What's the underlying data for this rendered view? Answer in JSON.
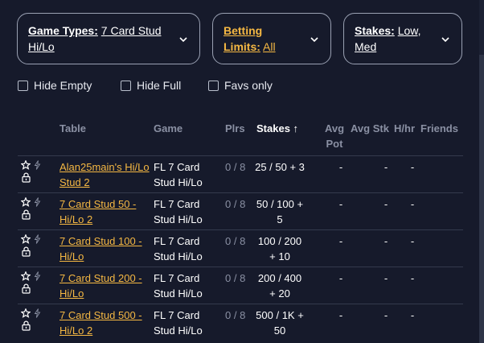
{
  "filters": {
    "game_types": {
      "label": "Game Types:",
      "value": "7 Card Stud Hi/Lo"
    },
    "betting_limits": {
      "label": "Betting Limits:",
      "value": "All"
    },
    "stakes": {
      "label": "Stakes:",
      "value": "Low, Med"
    }
  },
  "checkboxes": {
    "hide_empty": "Hide Empty",
    "hide_full": "Hide Full",
    "favs_only": "Favs only"
  },
  "table": {
    "headers": {
      "table": "Table",
      "game": "Game",
      "plrs": "Plrs",
      "stakes": "Stakes",
      "sort_arrow": "↑",
      "avg_pot": "Avg Pot",
      "avg_stk": "Avg Stk",
      "hhr": "H/hr",
      "friends": "Friends"
    },
    "rows": [
      {
        "name": "Alan25main's Hi/Lo Stud 2",
        "game": "FL 7 Card Stud Hi/Lo",
        "plrs": "0 / 8",
        "stakes": "25 / 50 + 3",
        "avg_pot": "-",
        "avg_stk": "-",
        "hhr": "-",
        "friends": ""
      },
      {
        "name": "7 Card Stud 50 - Hi/Lo 2",
        "game": "FL 7 Card Stud Hi/Lo",
        "plrs": "0 / 8",
        "stakes": "50 / 100 + 5",
        "avg_pot": "-",
        "avg_stk": "-",
        "hhr": "-",
        "friends": ""
      },
      {
        "name": "7 Card Stud 100 - Hi/Lo",
        "game": "FL 7 Card Stud Hi/Lo",
        "plrs": "0 / 8",
        "stakes": "100 / 200 + 10",
        "avg_pot": "-",
        "avg_stk": "-",
        "hhr": "-",
        "friends": ""
      },
      {
        "name": "7 Card Stud 200 - Hi/Lo",
        "game": "FL 7 Card Stud Hi/Lo",
        "plrs": "0 / 8",
        "stakes": "200 / 400 + 20",
        "avg_pot": "-",
        "avg_stk": "-",
        "hhr": "-",
        "friends": ""
      },
      {
        "name": "7 Card Stud 500 - Hi/Lo 2",
        "game": "FL 7 Card Stud Hi/Lo",
        "plrs": "0 / 8",
        "stakes": "500 / 1K + 50",
        "avg_pot": "-",
        "avg_stk": "-",
        "hhr": "-",
        "friends": ""
      }
    ]
  },
  "colors": {
    "background": "#161a2b",
    "accent": "#f5b843",
    "muted_text": "#8a90a3",
    "divider": "#343a4d"
  },
  "icons": [
    "chevron-down-icon",
    "star-icon",
    "lightning-icon",
    "lock-icon"
  ]
}
